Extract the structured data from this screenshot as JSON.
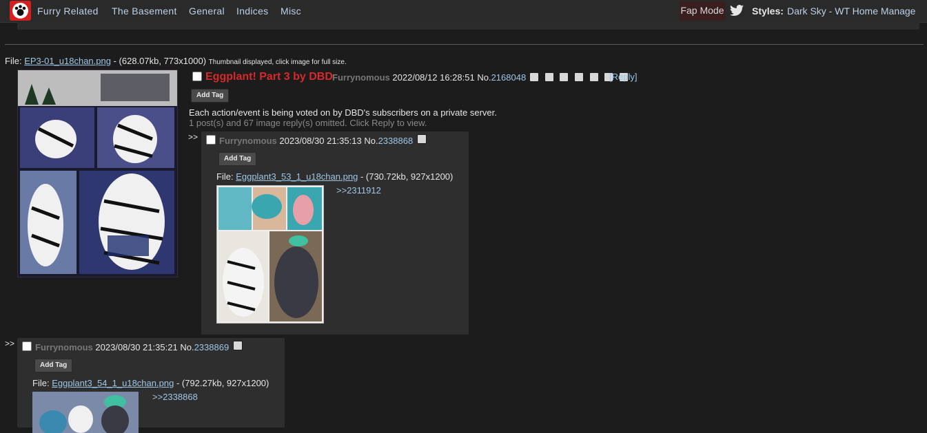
{
  "nav": {
    "items": [
      "Furry Related",
      "The Basement",
      "General",
      "Indices",
      "Misc"
    ],
    "fap_mode": "Fap Mode",
    "styles_label": "Styles:",
    "styles_links": "Dark Sky - WT Home Manage"
  },
  "op": {
    "file_label": "File:",
    "file_name": "EP3-01_u18chan.png",
    "file_meta": "- (628.07kb, 773x1000)",
    "thumb_note": "Thumbnail displayed, click image for full size.",
    "subject": "Eggplant! Part 3 by DBD",
    "poster": "Furrynomous",
    "date": "2022/08/12 16:28:51",
    "no_label": "No.",
    "post_no": "2168048",
    "reply_link": "[Reply]",
    "add_tag": "Add Tag",
    "comment": "Each action/event is being voted on by DBD's subscribers on a private server.",
    "omitted": "1 post(s) and 67 image reply(s) omitted. Click Reply to view."
  },
  "replies": [
    {
      "arrow": ">>",
      "poster": "Furrynomous",
      "date": "2023/08/30 21:35:13",
      "no_label": "No.",
      "post_no": "2338868",
      "add_tag": "Add Tag",
      "file_label": "File:",
      "file_name": "Eggplant3_53_1_u18chan.png",
      "file_meta": "- (730.72kb, 927x1200)",
      "quote": ">>2311912"
    },
    {
      "arrow": ">>",
      "poster": "Furrynomous",
      "date": "2023/08/30 21:35:21",
      "no_label": "No.",
      "post_no": "2338869",
      "add_tag": "Add Tag",
      "file_label": "File:",
      "file_name": "Eggplant3_54_1_u18chan.png",
      "file_meta": "- (792.27kb, 927x1200)",
      "quote": ">>2338868"
    }
  ]
}
